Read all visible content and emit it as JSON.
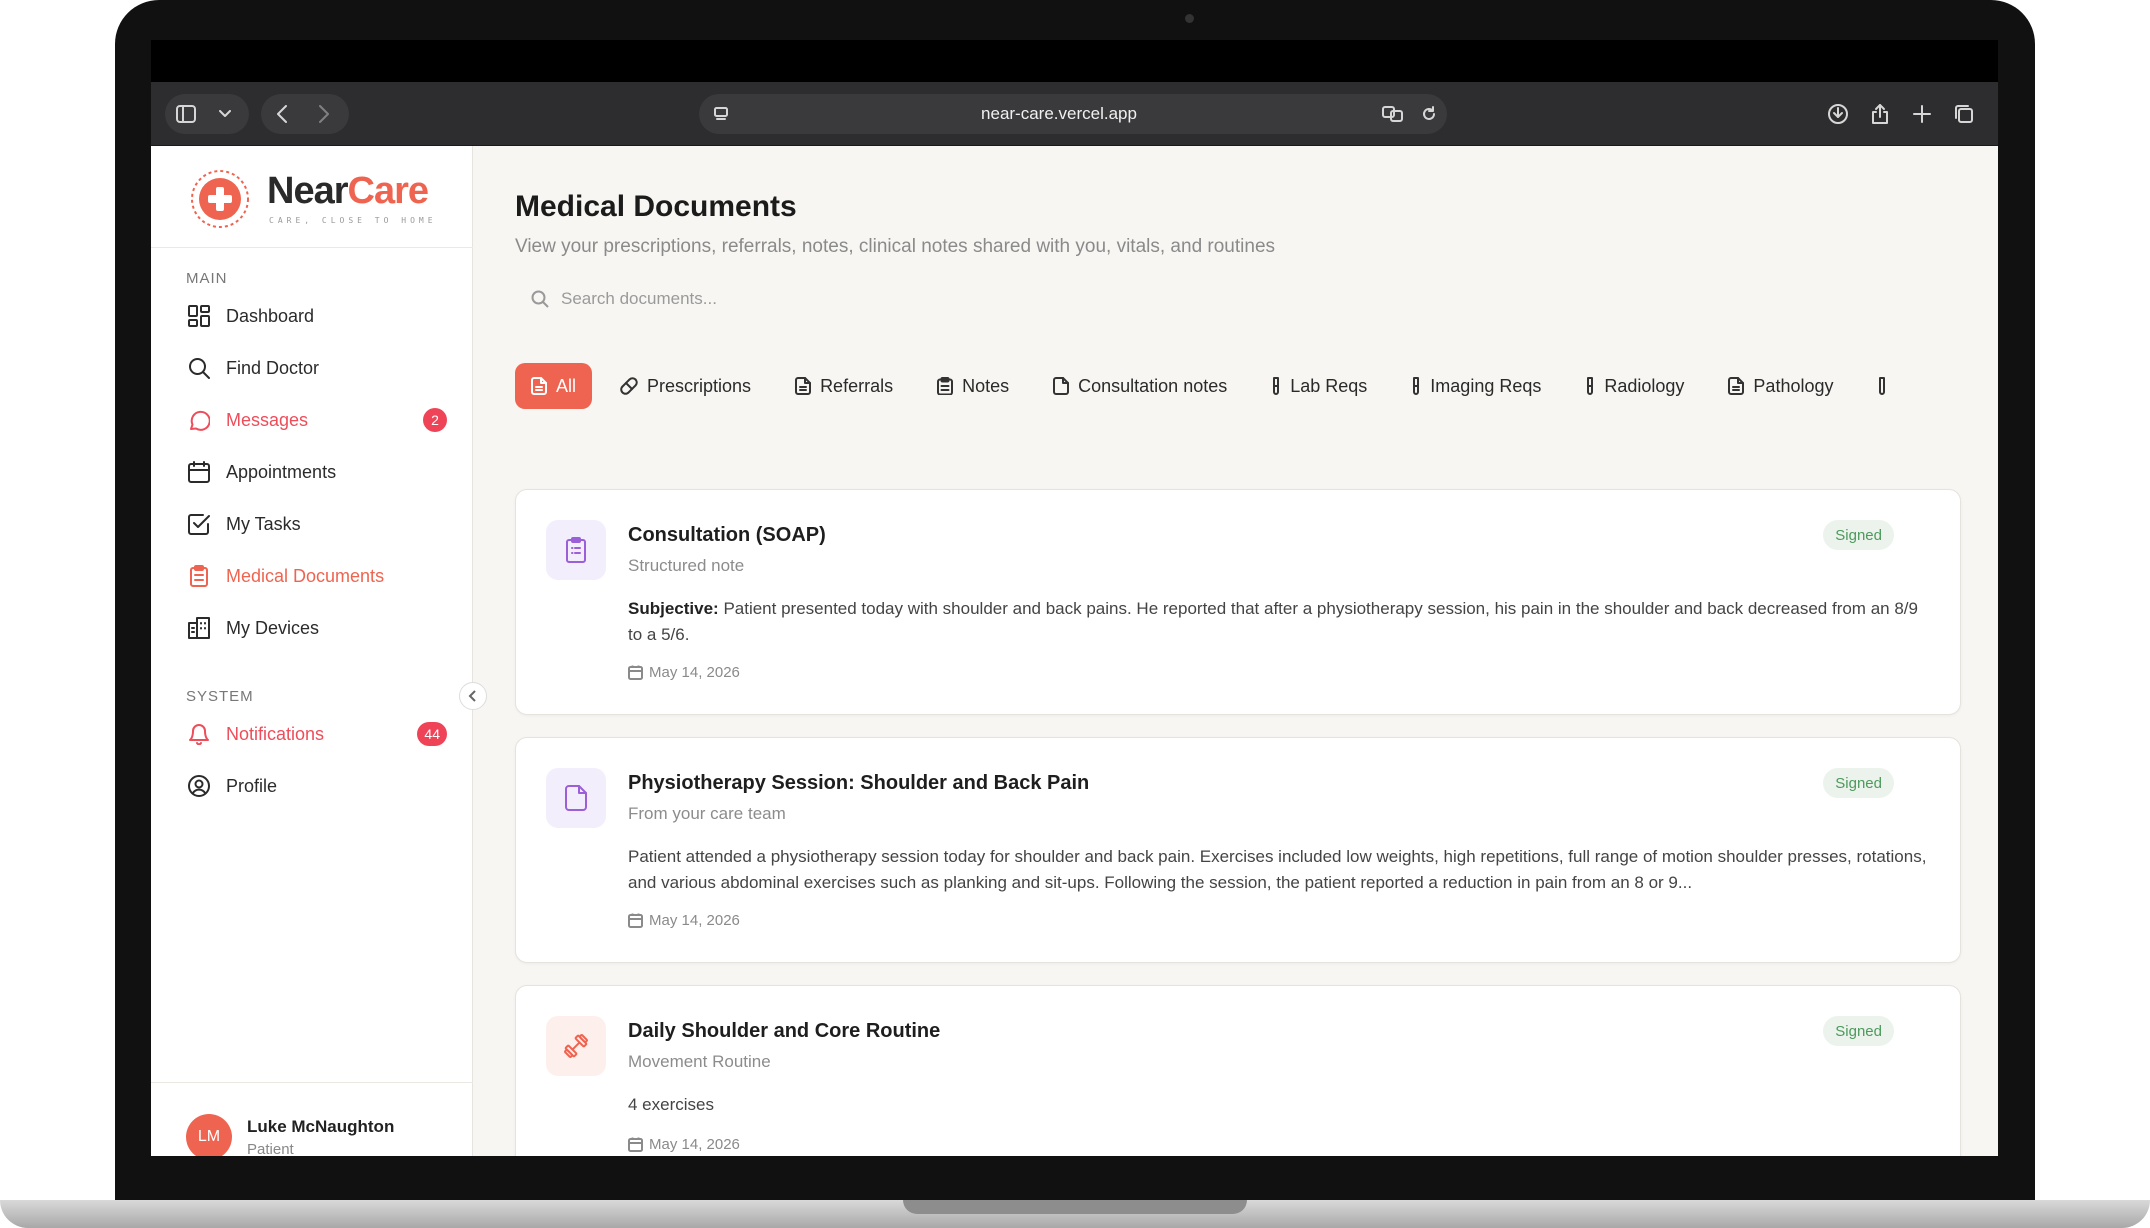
{
  "browser": {
    "url": "near-care.vercel.app"
  },
  "brand": {
    "name_part1": "Near",
    "name_part2": "Care",
    "tagline": "CARE, CLOSE TO HOME"
  },
  "sidebar": {
    "main_label": "MAIN",
    "system_label": "SYSTEM",
    "items": [
      {
        "label": "Dashboard",
        "icon": "dashboard-icon"
      },
      {
        "label": "Find Doctor",
        "icon": "search-icon"
      },
      {
        "label": "Messages",
        "icon": "message-icon",
        "badge": "2"
      },
      {
        "label": "Appointments",
        "icon": "calendar-icon"
      },
      {
        "label": "My Tasks",
        "icon": "checkbox-icon"
      },
      {
        "label": "Medical Documents",
        "icon": "clipboard-icon"
      },
      {
        "label": "My Devices",
        "icon": "building-icon"
      }
    ],
    "system_items": [
      {
        "label": "Notifications",
        "icon": "bell-icon",
        "badge": "44"
      },
      {
        "label": "Profile",
        "icon": "user-circle-icon"
      }
    ]
  },
  "user": {
    "initials": "LM",
    "name": "Luke McNaughton",
    "role": "Patient"
  },
  "main": {
    "title": "Medical Documents",
    "subtitle": "View your prescriptions, referrals, notes, clinical notes shared with you, vitals, and routines",
    "search_placeholder": "Search documents...",
    "filters": [
      {
        "label": "All",
        "icon": "file-icon"
      },
      {
        "label": "Prescriptions",
        "icon": "pill-icon"
      },
      {
        "label": "Referrals",
        "icon": "file-text-icon"
      },
      {
        "label": "Notes",
        "icon": "clipboard-icon"
      },
      {
        "label": "Consultation notes",
        "icon": "file-icon"
      },
      {
        "label": "Lab Reqs",
        "icon": "test-tube-icon"
      },
      {
        "label": "Imaging Reqs",
        "icon": "test-tube-icon"
      },
      {
        "label": "Radiology",
        "icon": "test-tube-icon"
      },
      {
        "label": "Pathology",
        "icon": "file-text-icon"
      }
    ],
    "documents": [
      {
        "title": "Consultation (SOAP)",
        "subtitle": "Structured note",
        "body_label": "Subjective:",
        "body": "Patient presented today with shoulder and back pains. He reported that after a physiotherapy session, his pain in the shoulder and back decreased from an 8/9 to a 5/6.",
        "date": "May 14, 2026",
        "status": "Signed",
        "icon": "clipboard-icon"
      },
      {
        "title": "Physiotherapy Session: Shoulder and Back Pain",
        "subtitle": "From your care team",
        "body": "Patient attended a physiotherapy session today for shoulder and back pain. Exercises included low weights, high repetitions, full range of motion shoulder presses, rotations, and various abdominal exercises such as planking and sit-ups. Following the session, the patient reported a reduction in pain from an 8 or 9...",
        "date": "May 14, 2026",
        "status": "Signed",
        "icon": "file-icon"
      },
      {
        "title": "Daily Shoulder and Core Routine",
        "subtitle": "Movement Routine",
        "body": "4 exercises",
        "date": "May 14, 2026",
        "status": "Signed",
        "icon": "dumbbell-icon"
      }
    ]
  }
}
